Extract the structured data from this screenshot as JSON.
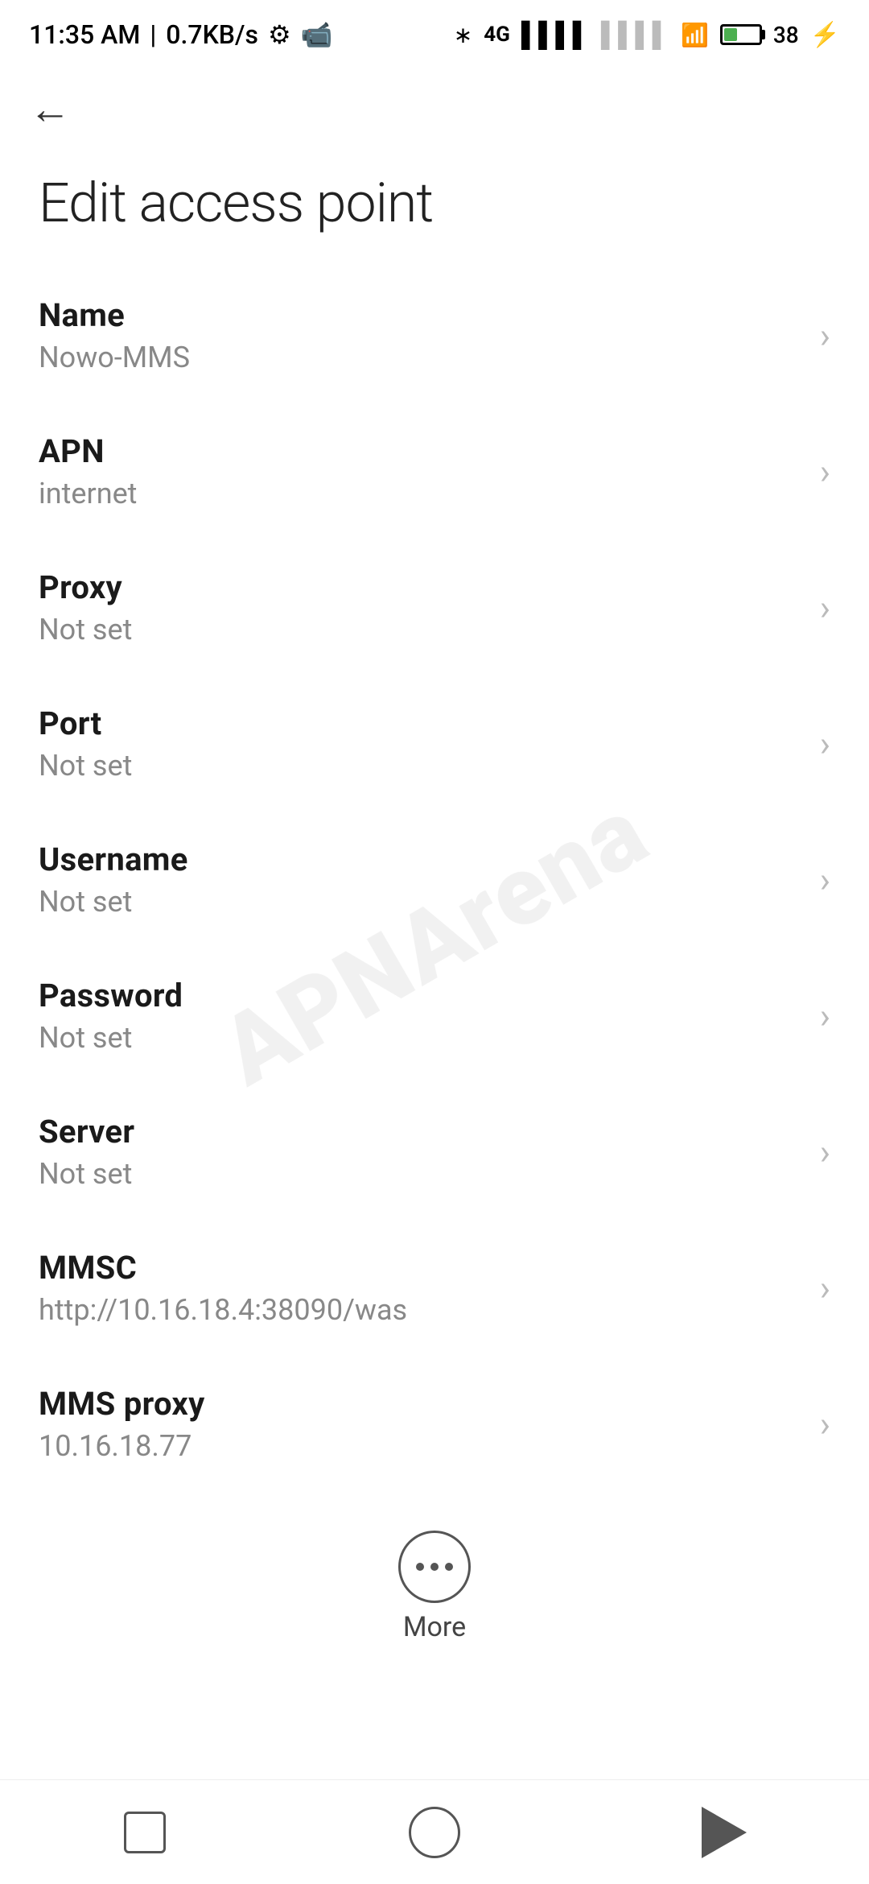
{
  "statusBar": {
    "time": "11:35 AM",
    "speed": "0.7KB/s"
  },
  "pageTitle": "Edit access point",
  "backButton": "←",
  "settings": [
    {
      "label": "Name",
      "value": "Nowo-MMS"
    },
    {
      "label": "APN",
      "value": "internet"
    },
    {
      "label": "Proxy",
      "value": "Not set"
    },
    {
      "label": "Port",
      "value": "Not set"
    },
    {
      "label": "Username",
      "value": "Not set"
    },
    {
      "label": "Password",
      "value": "Not set"
    },
    {
      "label": "Server",
      "value": "Not set"
    },
    {
      "label": "MMSC",
      "value": "http://10.16.18.4:38090/was"
    },
    {
      "label": "MMS proxy",
      "value": "10.16.18.77"
    }
  ],
  "moreButton": {
    "label": "More"
  },
  "watermark": "APNArena"
}
